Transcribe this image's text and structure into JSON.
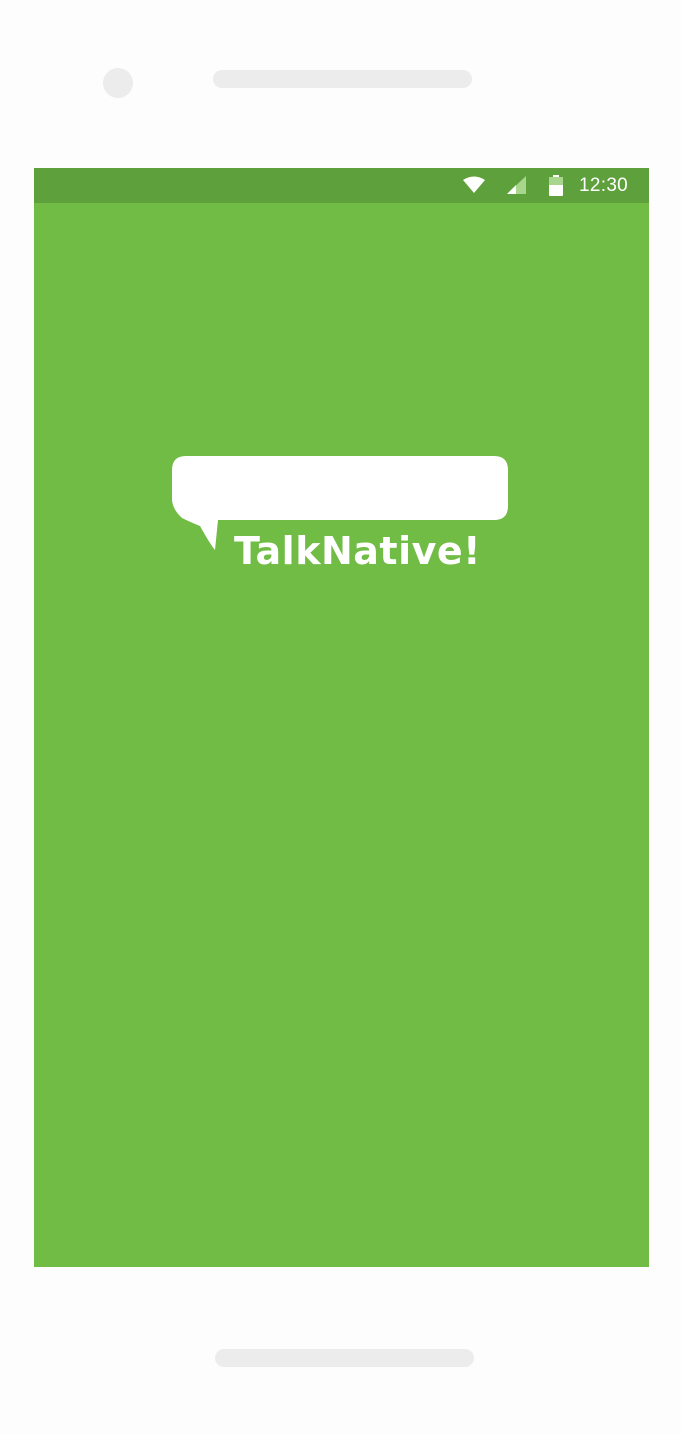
{
  "status_bar": {
    "time": "12:30",
    "icons": [
      "wifi-icon",
      "cellular-signal-icon",
      "battery-icon"
    ]
  },
  "app": {
    "name": "TalkNative!"
  },
  "colors": {
    "screen_background": "#70bc45",
    "status_bar_background": "#5ea03b",
    "logo": "#ffffff",
    "device_frame": "#fdfdfd",
    "device_details": "#ececec"
  }
}
